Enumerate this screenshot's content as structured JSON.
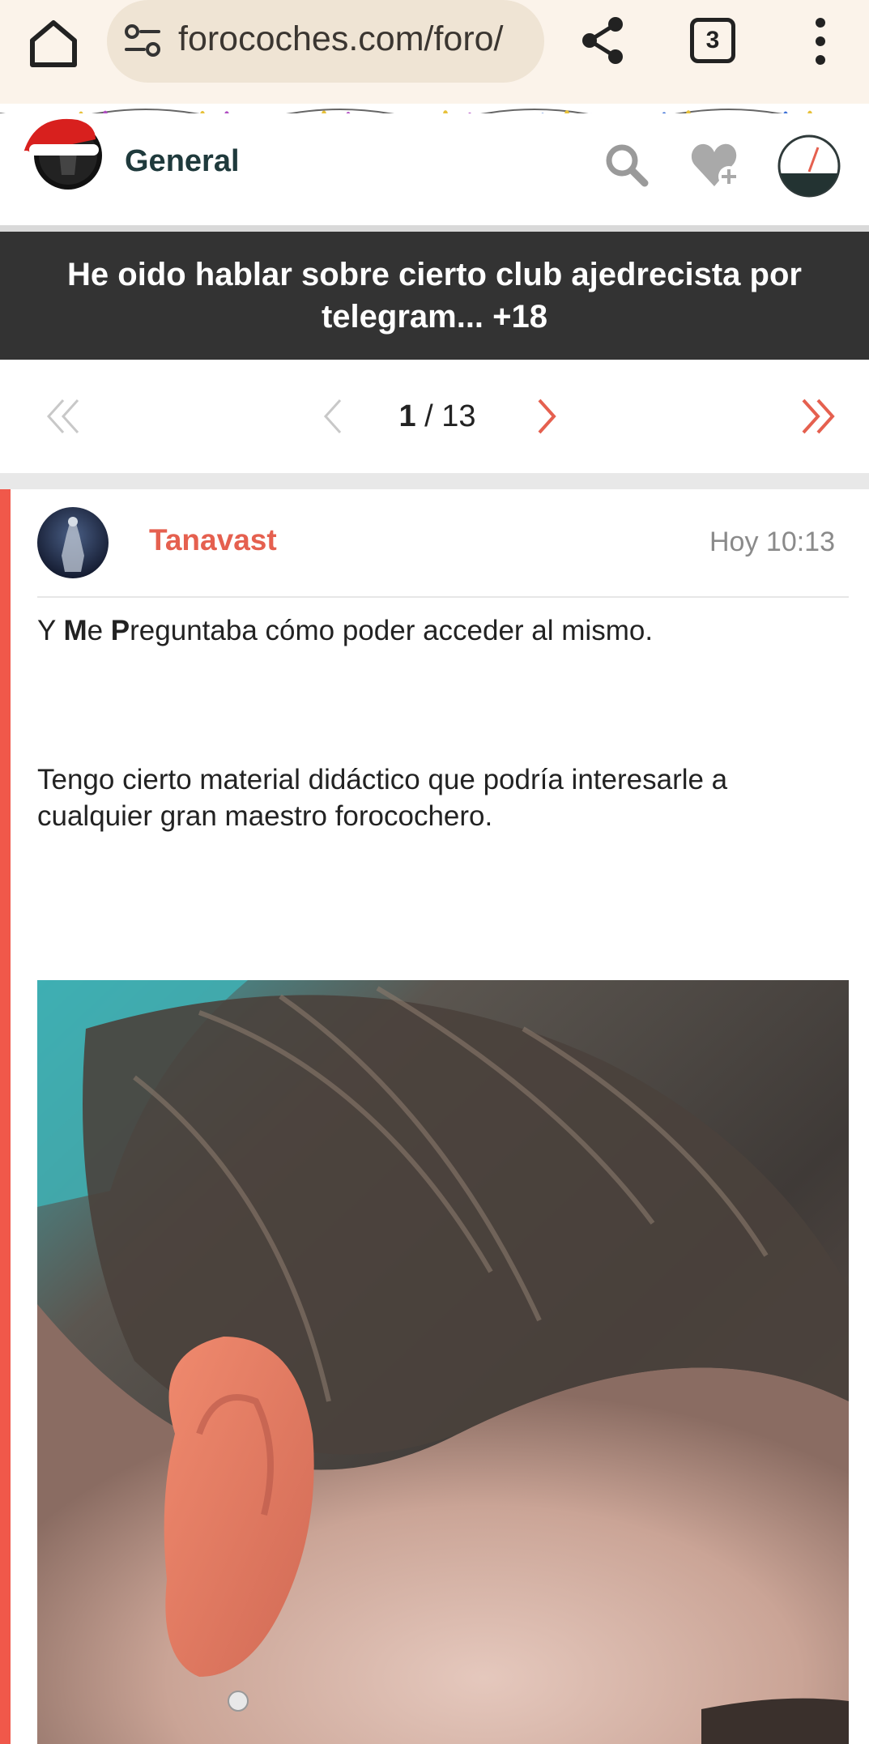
{
  "browser": {
    "url": "forocoches.com/foro/",
    "tab_count": "3"
  },
  "header": {
    "forum_name": "General"
  },
  "thread": {
    "title": "He oido hablar sobre cierto club ajedrecista por telegram... +18"
  },
  "pagination": {
    "current": "1",
    "separator": " / ",
    "total": "13"
  },
  "post": {
    "username": "Tanavast",
    "time": "Hoy 10:13",
    "paragraph1": {
      "a": "Y ",
      "b1": "M",
      "c": "e ",
      "b2": "P",
      "d": "reguntaba cómo poder acceder al mismo."
    },
    "paragraph2": "Tengo cierto material didáctico que podría interesarle a cualquier gran maestro forocochero."
  },
  "colors": {
    "accent": "#e5604f",
    "title_bar": "#333333",
    "forum_name": "#1f3a3c"
  },
  "icons": [
    "home-icon",
    "tune-icon",
    "share-icon",
    "more-vert-icon",
    "search-icon",
    "heart-plus-icon",
    "speedometer-icon",
    "double-chevron-left-icon",
    "chevron-left-icon",
    "chevron-right-icon",
    "double-chevron-right-icon"
  ]
}
